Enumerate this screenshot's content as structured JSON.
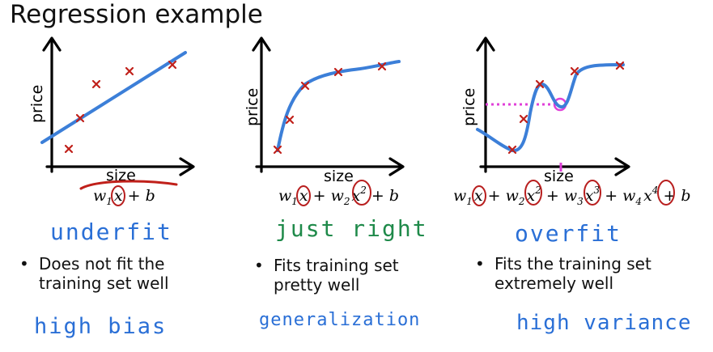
{
  "title": "Regression example",
  "colors": {
    "curve": "#3c7fd8",
    "marker": "#c0201a",
    "circle": "#b81e1e",
    "dotted": "#e040d8",
    "blue_hand": "#2a6fd6",
    "green_hand": "#1f8a4a"
  },
  "panels": [
    {
      "id": "underfit",
      "xlabel": "size",
      "ylabel": "price",
      "formula": "w₁x + b",
      "fit_label": "underfit",
      "fit_label_color": "blue",
      "description": "Does not fit the training set well",
      "description_lines": [
        "Does not fit the",
        "training set well"
      ],
      "diagnosis": "high bias",
      "model": "linear"
    },
    {
      "id": "just-right",
      "xlabel": "size",
      "ylabel": "price",
      "formula": "w₁x + w₂x² + b",
      "fit_label": "just right",
      "fit_label_color": "green",
      "description": "Fits training set pretty well",
      "description_lines": [
        "Fits training set",
        "pretty well"
      ],
      "diagnosis": "generalization",
      "model": "quadratic"
    },
    {
      "id": "overfit",
      "xlabel": "size",
      "ylabel": "price",
      "formula": "w₁x + w₂x² + w₃x³ + w₄x⁴ + b",
      "fit_label": "overfit",
      "fit_label_color": "blue",
      "description": "Fits the training set extremely well",
      "description_lines": [
        "Fits the training set",
        "extremely well"
      ],
      "diagnosis": "high variance",
      "model": "4th-order polynomial"
    }
  ],
  "icons": {
    "marker": "x-marker-icon",
    "axis_arrow": "arrow-icon",
    "bullet": "bullet-icon"
  }
}
